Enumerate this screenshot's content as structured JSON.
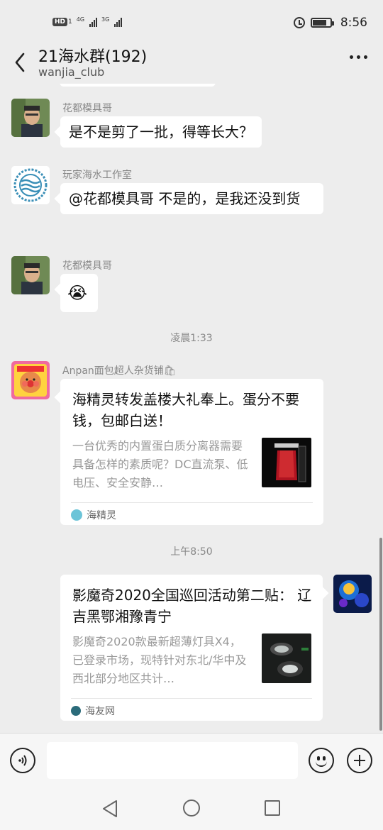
{
  "status_bar": {
    "hd": "HD",
    "hd_sub": "1",
    "net1": "4G",
    "net2": "3G",
    "time": "8:56"
  },
  "header": {
    "title": "21海水群(192)",
    "subtitle": "wanjia_club"
  },
  "messages": [
    {
      "sender": "花都模具哥",
      "text": "是不是剪了一批，得等长大？"
    },
    {
      "sender": "玩家海水工作室",
      "text": "@花都模具哥  不是的，是我还没到货"
    },
    {
      "sender": "花都模具哥",
      "emoji": "😭"
    }
  ],
  "time_separators": [
    "凌晨1:33",
    "上午8:50"
  ],
  "share_cards": [
    {
      "sender": "Anpan面包超人杂货铺🛍",
      "title": "海精灵转发盖楼大礼奉上。蛋分不要钱，包邮白送！",
      "desc": "一台优秀的内置蛋白质分离器需要具备怎样的素质呢？DC直流泵、低电压、安全安静…",
      "source": "海精灵"
    },
    {
      "title": "影魔奇2020全国巡回活动第二贴： 辽吉黑鄂湘豫青宁",
      "desc": "影魔奇2020款最新超薄灯具X4，已登录市场，现特针对东北/华中及西北部分地区共计…",
      "source": "海友网"
    }
  ],
  "input": {
    "value": "",
    "placeholder": ""
  },
  "icons": {
    "back": "chevron-left-icon",
    "more": "more-dots-icon",
    "voice": "voice-icon",
    "emoji": "emoji-icon",
    "plus": "plus-icon"
  }
}
